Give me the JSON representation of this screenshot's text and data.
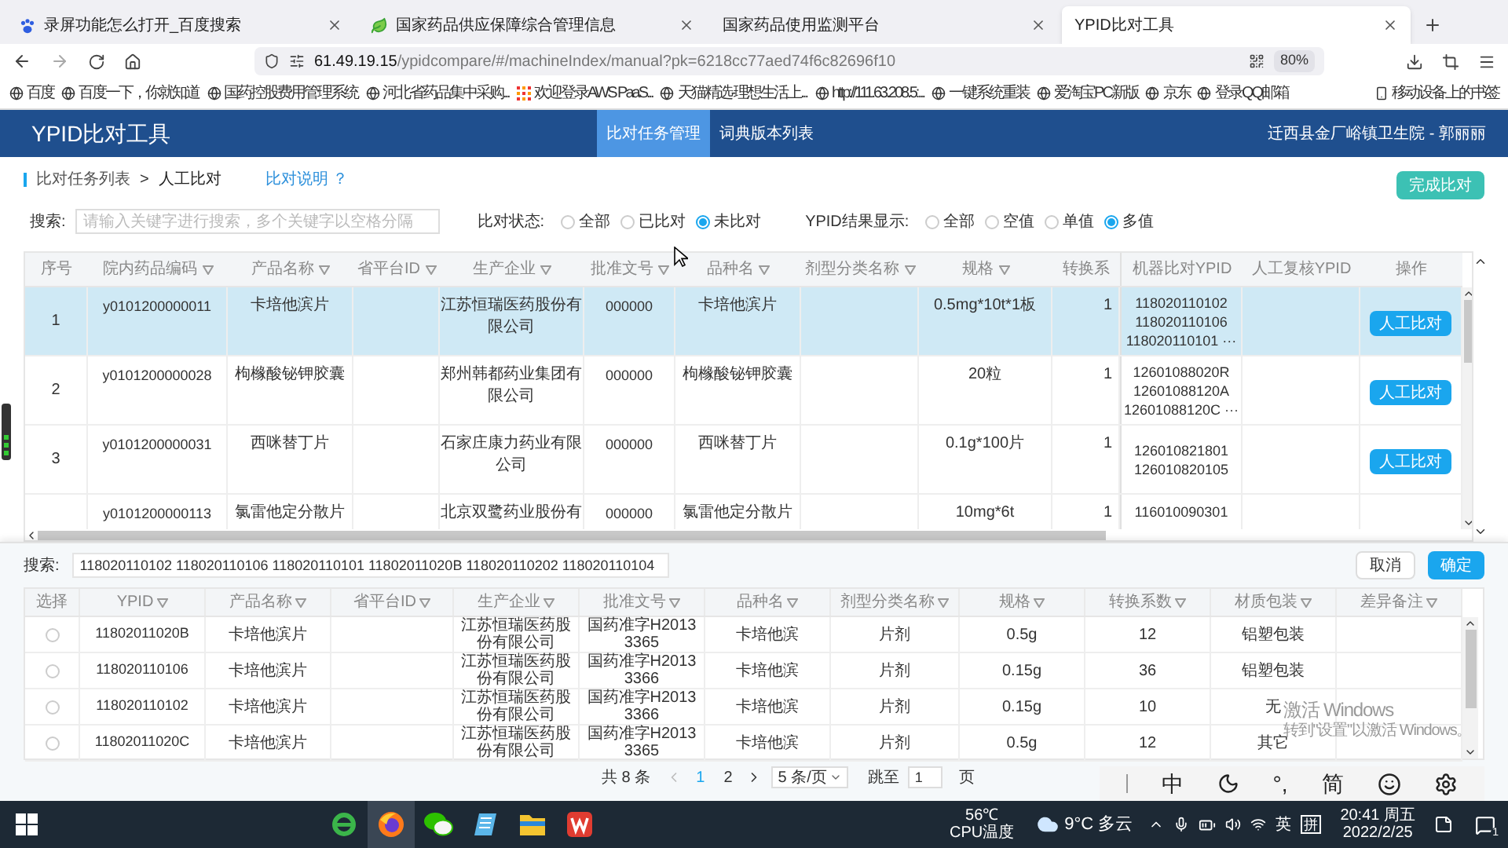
{
  "browser": {
    "tabs": [
      {
        "title": "录屏功能怎么打开_百度搜索",
        "kind": "paw",
        "selected": false
      },
      {
        "title": "国家药品供应保障综合管理信息",
        "kind": "leaf",
        "selected": false
      },
      {
        "title": "国家药品使用监测平台",
        "kind": "plain",
        "selected": false
      },
      {
        "title": "YPID比对工具",
        "kind": "plain",
        "selected": true
      }
    ],
    "url_host": "61.49.19.15",
    "url_path": "/ypidcompare/#/machineIndex/manual?pk=6218cc77aed74f6c82696f10",
    "zoom": "80%",
    "bookmarks": [
      {
        "label": "百度",
        "kind": "globe"
      },
      {
        "label": "百度一下，你就知道",
        "kind": "globe"
      },
      {
        "label": "国药控股费用管理系统",
        "kind": "globe"
      },
      {
        "label": "河北省药品集中采购...",
        "kind": "globe"
      },
      {
        "label": "欢迎登录AWS PaaS...",
        "kind": "grid"
      },
      {
        "label": "天猫精选-理想生活上...",
        "kind": "globe"
      },
      {
        "label": "http://111.63.208.5:...",
        "kind": "globe"
      },
      {
        "label": "一键系统重装",
        "kind": "globe"
      },
      {
        "label": "爱淘宝PC新版",
        "kind": "globe"
      },
      {
        "label": "京东",
        "kind": "globe"
      },
      {
        "label": "登录QQ邮箱",
        "kind": "globe"
      },
      {
        "label": "移动设备上的书签",
        "kind": "phone"
      }
    ]
  },
  "app": {
    "title": "YPID比对工具",
    "nav": [
      {
        "label": "比对任务管理",
        "selected": true
      },
      {
        "label": "词典版本列表",
        "selected": false
      }
    ],
    "user": "迁西县金厂峪镇卫生院 - 郭丽丽"
  },
  "breadcrumb": {
    "items": [
      "比对任务列表",
      "人工比对"
    ],
    "separator": ">"
  },
  "help_link": "比对说明 ？",
  "finish_button": "完成比对",
  "filters": {
    "search_label": "搜索:",
    "search_placeholder": "请输入关键字进行搜索，多个关键字以空格分隔",
    "groups": [
      {
        "label": "比对状态:",
        "options": [
          {
            "label": "全部",
            "selected": false
          },
          {
            "label": "已比对",
            "selected": false
          },
          {
            "label": "未比对",
            "selected": true
          }
        ]
      },
      {
        "label": "YPID结果显示:",
        "options": [
          {
            "label": "全部",
            "selected": false
          },
          {
            "label": "空值",
            "selected": false
          },
          {
            "label": "单值",
            "selected": false
          },
          {
            "label": "多值",
            "selected": true
          }
        ]
      }
    ]
  },
  "table": {
    "columns": [
      {
        "label": "序号",
        "kind": "index",
        "filter": false
      },
      {
        "label": "院内药品编码",
        "kind": "code",
        "filter": true
      },
      {
        "label": "产品名称",
        "kind": "text",
        "filter": true
      },
      {
        "label": "省平台ID",
        "filter": true
      },
      {
        "label": "生产企业",
        "kind": "text",
        "filter": true
      },
      {
        "label": "批准文号",
        "kind": "code",
        "filter": true
      },
      {
        "label": "品种名",
        "kind": "text",
        "filter": true
      },
      {
        "label": "剂型分类名称",
        "filter": true
      },
      {
        "label": "规格",
        "kind": "text",
        "filter": true
      },
      {
        "label": "转换系",
        "kind": "number",
        "filter": false
      },
      {
        "label": "机器比对YPID",
        "kind": "list",
        "filter": false
      },
      {
        "label": "人工复核YPID",
        "filter": false
      },
      {
        "label": "操作",
        "kind": "action",
        "filter": false
      }
    ],
    "rows": [
      {
        "selected": true,
        "cells": [
          "1",
          "y0101200000011",
          "卡培他滨片",
          null,
          "江苏恒瑞医药股份有限公司",
          "000000",
          "卡培他滨片",
          null,
          "0.5mg*10t*1板",
          "1",
          [
            "118020110102",
            "118020110106",
            "118020110101 ···"
          ],
          null,
          "人工比对"
        ]
      },
      {
        "selected": false,
        "cells": [
          "2",
          "y0101200000028",
          "枸橼酸铋钾胶囊",
          null,
          "郑州韩都药业集团有限公司",
          "000000",
          "枸橼酸铋钾胶囊",
          null,
          "20粒",
          "1",
          [
            "12601088020R",
            "12601088120A",
            "12601088120C ···"
          ],
          null,
          "人工比对"
        ]
      },
      {
        "selected": false,
        "cells": [
          "3",
          "y0101200000031",
          "西咪替丁片",
          null,
          "石家庄康力药业有限公司",
          "000000",
          "西咪替丁片",
          null,
          "0.1g*100片",
          "1",
          [
            "126010821801",
            "126010820105"
          ],
          null,
          "人工比对"
        ]
      },
      {
        "selected": false,
        "cells": [
          null,
          "y0101200000113",
          "氯雷他定分散片",
          null,
          "北京双鹭药业股份有",
          "000000",
          "氯雷他定分散片",
          null,
          "10mg*6t",
          "1",
          [
            "116010090301"
          ],
          null,
          null
        ]
      }
    ]
  },
  "picker": {
    "search_label": "搜索:",
    "search_value": "118020110102 118020110106 118020110101 11802011020B 118020110202 118020110104",
    "buttons": [
      {
        "label": "取消",
        "kind": "default"
      },
      {
        "label": "确定",
        "kind": "primary"
      }
    ],
    "columns": [
      {
        "label": "选择",
        "kind": "radio",
        "filter": false
      },
      {
        "label": "YPID",
        "kind": "code",
        "filter": true
      },
      {
        "label": "产品名称",
        "kind": "text",
        "filter": true
      },
      {
        "label": "省平台ID",
        "kind": "text",
        "filter": true
      },
      {
        "label": "生产企业",
        "kind": "text",
        "filter": true
      },
      {
        "label": "批准文号",
        "kind": "text",
        "filter": true
      },
      {
        "label": "品种名",
        "kind": "text",
        "filter": true
      },
      {
        "label": "剂型分类名称",
        "kind": "text",
        "filter": true
      },
      {
        "label": "规格",
        "kind": "text",
        "filter": true
      },
      {
        "label": "转换系数",
        "kind": "text",
        "filter": true
      },
      {
        "label": "材质包装",
        "kind": "text",
        "filter": true
      },
      {
        "label": "差异备注",
        "kind": "text",
        "filter": true
      }
    ],
    "rows": [
      {
        "selected": false,
        "cells": [
          null,
          "11802011020B",
          "卡培他滨片",
          null,
          "江苏恒瑞医药股份有限公司",
          "国药准字H20133365",
          "卡培他滨",
          "片剂",
          "0.5g",
          "12",
          "铝塑包装",
          null
        ]
      },
      {
        "selected": false,
        "cells": [
          null,
          "118020110106",
          "卡培他滨片",
          null,
          "江苏恒瑞医药股份有限公司",
          "国药准字H20133366",
          "卡培他滨",
          "片剂",
          "0.15g",
          "36",
          "铝塑包装",
          null
        ]
      },
      {
        "selected": false,
        "cells": [
          null,
          "118020110102",
          "卡培他滨片",
          null,
          "江苏恒瑞医药股份有限公司",
          "国药准字H20133366",
          "卡培他滨",
          "片剂",
          "0.15g",
          "10",
          "无",
          null
        ]
      },
      {
        "selected": false,
        "cells": [
          null,
          "11802011020C",
          "卡培他滨片",
          null,
          "江苏恒瑞医药股份有限公司",
          "国药准字H20133365",
          "卡培他滨",
          "片剂",
          "0.5g",
          "12",
          "其它",
          null
        ]
      }
    ],
    "pagination": {
      "total": "共 8 条",
      "pages": [
        {
          "label": "1",
          "selected": true
        },
        {
          "label": "2",
          "selected": false
        }
      ],
      "page_size": "5 条/页",
      "jump_label": "跳至",
      "jump_value": "1",
      "page_unit": "页"
    }
  },
  "activation": {
    "title": "激活 Windows",
    "subtitle": "转到\"设置\"以激活 Windows。"
  },
  "ime_bar": {
    "items": [
      "中",
      "°,",
      "简"
    ]
  },
  "taskbar": {
    "apps": [
      {
        "kind": "ie",
        "selected": false
      },
      {
        "kind": "firefox",
        "selected": true
      },
      {
        "kind": "chat",
        "selected": false
      },
      {
        "kind": "notepad",
        "selected": false
      },
      {
        "kind": "folder",
        "selected": false
      },
      {
        "kind": "office",
        "selected": false
      }
    ],
    "cpu_value": "56℃",
    "cpu_label": "CPU温度",
    "weather_temp": "9°C",
    "weather_desc": "多云",
    "lang": "英",
    "ime_mode": "拼",
    "time": "20:41 周五",
    "date": "2022/2/25",
    "notifications": "1"
  }
}
